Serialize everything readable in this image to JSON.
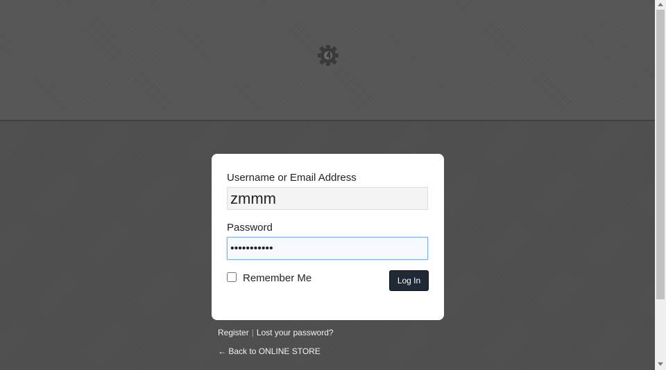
{
  "header": {
    "logo_icon": "gear-badge-icon"
  },
  "form": {
    "username_label": "Username or Email Address",
    "username_value": "zmmm",
    "password_label": "Password",
    "password_value": "•••••••••••",
    "remember_label": "Remember Me",
    "login_button": "Log In"
  },
  "links": {
    "register": "Register",
    "separator": "|",
    "lost_password": "Lost your password?",
    "back": "← Back to ONLINE STORE"
  },
  "colors": {
    "background": "#4f4f4f",
    "button": "#1f2a36",
    "focus_border": "#7fb2e6"
  }
}
